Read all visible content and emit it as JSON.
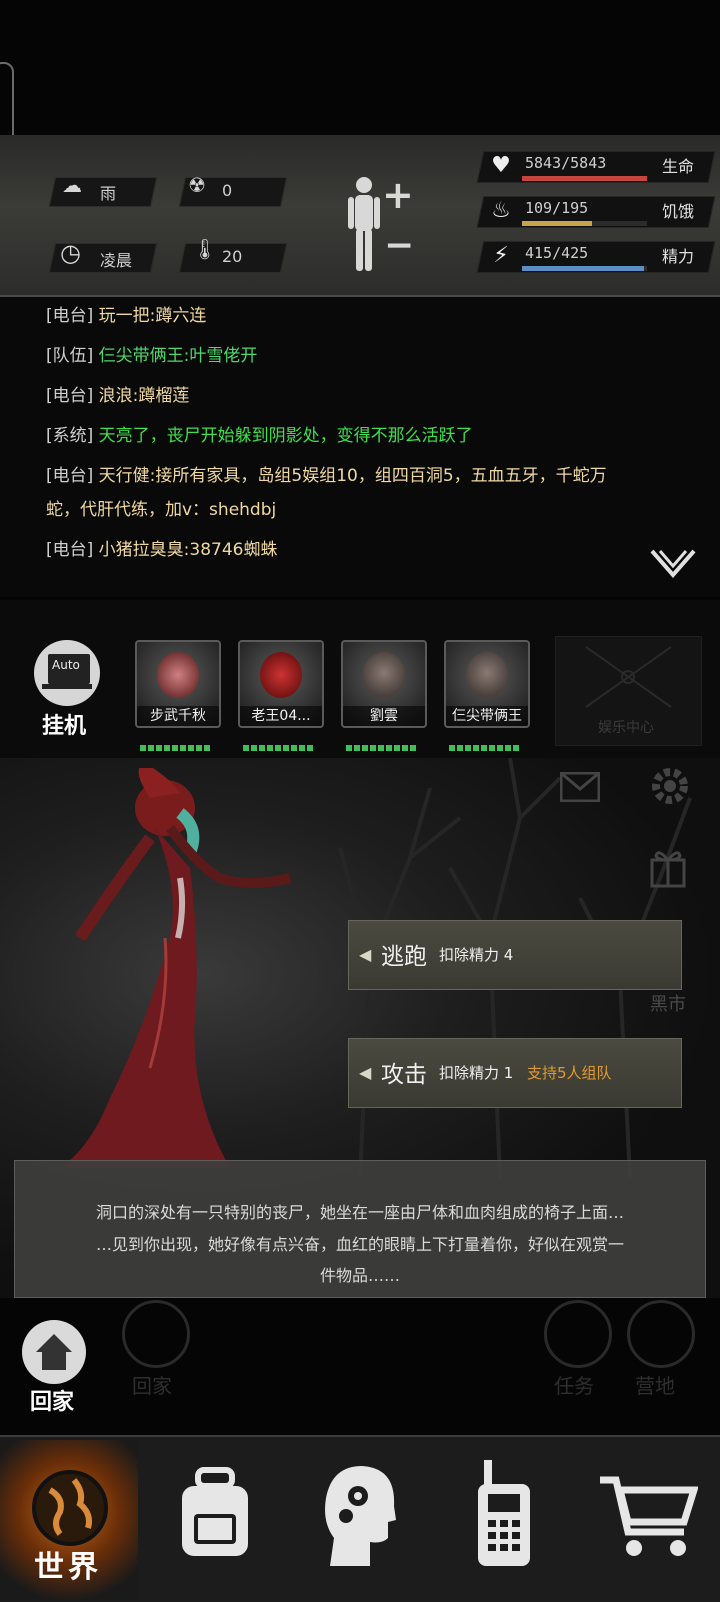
{
  "environment": {
    "weather": "雨",
    "radiation": "0",
    "time_of_day": "凌晨",
    "temperature": "20"
  },
  "body_status": {
    "add_label": "+",
    "remove_label": "−"
  },
  "stats": [
    {
      "icon": "heart-pulse-icon",
      "value": "5843/5843",
      "label": "生命",
      "fraction": 1.0,
      "color": "#c7453f"
    },
    {
      "icon": "stomach-icon",
      "value": "109/195",
      "label": "饥饿",
      "fraction": 0.56,
      "color": "#c9a24a"
    },
    {
      "icon": "energy-head-icon",
      "value": "415/425",
      "label": "精力",
      "fraction": 0.976,
      "color": "#5b8fc7"
    }
  ],
  "chat": {
    "messages": [
      {
        "channel": "[电台]",
        "text": "玩一把:蹲六连",
        "color": "#f0d9a0"
      },
      {
        "channel": "[队伍]",
        "text": "仨尖带俩王:叶雪佬开",
        "color": "#4fd86b"
      },
      {
        "channel": "[电台]",
        "text": "浪浪:蹲榴莲",
        "color": "#f0d9a0"
      },
      {
        "channel": "[系统]",
        "text": "天亮了，丧尸开始躲到阴影处，变得不那么活跃了",
        "color": "#3fe04a"
      },
      {
        "channel": "[电台]",
        "text": "天行健:接所有家具，岛组5娱组10，组四百洞5，五血五牙，千蛇万",
        "color": "#f0d9a0"
      },
      {
        "channel": "",
        "text": "蛇，代肝代练，加v：shehdbj",
        "color": "#f0d9a0"
      },
      {
        "channel": "[电台]",
        "text": "小猪拉臭臭:38746蜘蛛",
        "color": "#f0d9a0"
      }
    ]
  },
  "auto": {
    "badge": "Auto",
    "label": "挂机"
  },
  "party": [
    {
      "name": "步武千秋",
      "hp_pips": 9
    },
    {
      "name": "老王04...",
      "hp_pips": 9
    },
    {
      "name": "劉雲",
      "hp_pips": 9
    },
    {
      "name": "仨尖带俩王",
      "hp_pips": 9
    }
  ],
  "entertainment_label": "娱乐中心",
  "side_labels": {
    "black_market": "黑市"
  },
  "actions": {
    "flee": {
      "label": "逃跑",
      "cost": "扣除精力 4"
    },
    "attack": {
      "label": "攻击",
      "cost": "扣除精力 1",
      "note": "支持5人组队"
    }
  },
  "narration": [
    "洞口的深处有一只特别的丧尸，她坐在一座由尸体和血肉组成的椅子上面…",
    "…见到你出现，她好像有点兴奋，血红的眼睛上下打量着你，好似在观赏一",
    "件物品……"
  ],
  "quick_buttons": {
    "home": "回家",
    "home_faded": "回家",
    "tasks": "任务",
    "camp": "营地"
  },
  "bottom_nav": {
    "world": "世界"
  }
}
